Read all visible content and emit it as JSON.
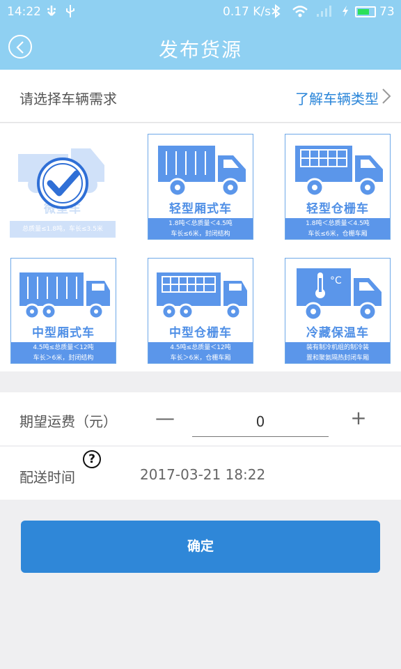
{
  "status_bar": {
    "time": "14:22",
    "speed": "0.17 K/s",
    "battery_percent": "73",
    "battery_level": 0.73
  },
  "header": {
    "title": "发布货源"
  },
  "vehicle_section": {
    "label": "请选择车辆需求",
    "link": "了解车辆类型",
    "vehicles": [
      {
        "name": "微型车",
        "desc_line1": "总质量≤1.8吨，车长≤3.5米",
        "desc_line2": "",
        "selected": true
      },
      {
        "name": "轻型厢式车",
        "desc_line1": "1.8吨＜总质量＜4.5吨",
        "desc_line2": "车长≤6米，封闭结构",
        "selected": false
      },
      {
        "name": "轻型仓栅车",
        "desc_line1": "1.8吨＜总质量＜4.5吨",
        "desc_line2": "车长≤6米，仓栅车厢",
        "selected": false
      },
      {
        "name": "中型厢式车",
        "desc_line1": "4.5吨≤总质量＜12吨",
        "desc_line2": "车长＞6米，封闭结构",
        "selected": false
      },
      {
        "name": "中型仓栅车",
        "desc_line1": "4.5吨≤总质量＜12吨",
        "desc_line2": "车长＞6米，仓栅车厢",
        "selected": false
      },
      {
        "name": "冷藏保温车",
        "desc_line1": "装有制冷机组的制冷装",
        "desc_line2": "置和聚氨隔热封闭车厢",
        "selected": false
      }
    ]
  },
  "freight": {
    "label": "期望运费（元）",
    "minus": "—",
    "value": "0",
    "plus": "+"
  },
  "delivery_time": {
    "label": "配送时间",
    "help": "?",
    "value": "2017-03-21 18:22"
  },
  "confirm_label": "确定",
  "colors": {
    "header_bg": "#8fd0f2",
    "accent": "#2f87d8",
    "vehicle_blue": "#5b96ea"
  }
}
